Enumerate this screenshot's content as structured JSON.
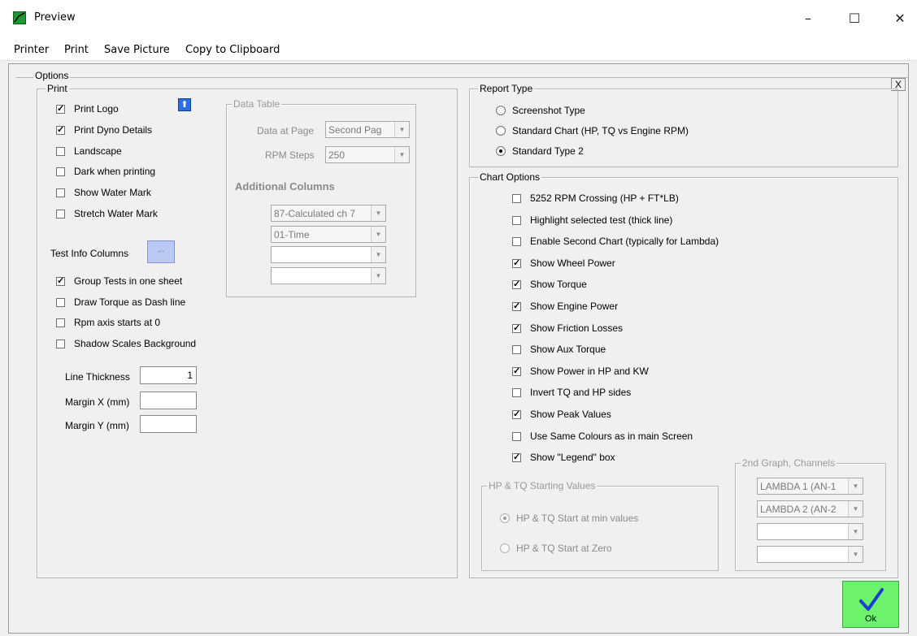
{
  "window": {
    "title": "Preview",
    "minimize": "–",
    "maximize": "☐",
    "close": "✕"
  },
  "menu": [
    "Printer",
    "Print",
    "Save Picture",
    "Copy to Clipboard"
  ],
  "options": {
    "legend": "Options",
    "close_label": "X",
    "print": {
      "legend": "Print",
      "checks": [
        {
          "label": "Print Logo",
          "checked": true
        },
        {
          "label": "Print Dyno Details",
          "checked": true
        },
        {
          "label": "Landscape",
          "checked": false
        },
        {
          "label": "Dark when printing",
          "checked": false
        },
        {
          "label": "Show Water Mark",
          "checked": false
        },
        {
          "label": "Stretch Water Mark",
          "checked": false
        }
      ],
      "test_info_label": "Test Info Columns",
      "more_button": "...",
      "checks2": [
        {
          "label": "Group Tests in one sheet",
          "checked": true
        },
        {
          "label": "Draw Torque as Dash line",
          "checked": false
        },
        {
          "label": "Rpm axis starts at 0",
          "checked": false
        },
        {
          "label": "Shadow Scales Background",
          "checked": false
        }
      ],
      "line_thickness_label": "Line Thickness",
      "line_thickness_value": "1",
      "margin_x_label": "Margin X (mm)",
      "margin_x_value": "",
      "margin_y_label": "Margin Y (mm)",
      "margin_y_value": ""
    },
    "data_table": {
      "legend": "Data Table",
      "data_at_page_label": "Data at Page",
      "data_at_page_value": "Second Pag",
      "rpm_steps_label": "RPM Steps",
      "rpm_steps_value": "250",
      "additional_columns_label": "Additional Columns",
      "columns": [
        "87-Calculated ch 7",
        "01-Time",
        "",
        ""
      ]
    },
    "report_type": {
      "legend": "Report Type",
      "items": [
        {
          "label": "Screenshot Type",
          "selected": false
        },
        {
          "label": "Standard Chart (HP, TQ vs Engine RPM)",
          "selected": false
        },
        {
          "label": "Standard Type 2",
          "selected": true
        }
      ]
    },
    "chart_options": {
      "legend": "Chart Options",
      "checks": [
        {
          "label": "5252 RPM Crossing (HP + FT*LB)",
          "checked": false
        },
        {
          "label": "Highlight selected test (thick line)",
          "checked": false
        },
        {
          "label": "Enable Second Chart (typically for Lambda)",
          "checked": false
        },
        {
          "label": "Show Wheel Power",
          "checked": true
        },
        {
          "label": "Show Torque",
          "checked": true
        },
        {
          "label": "Show Engine Power",
          "checked": true
        },
        {
          "label": "Show Friction Losses",
          "checked": true
        },
        {
          "label": "Show Aux Torque",
          "checked": false
        },
        {
          "label": "Show Power in HP and KW",
          "checked": true
        },
        {
          "label": "Invert TQ and HP sides",
          "checked": false
        },
        {
          "label": "Show Peak Values",
          "checked": true
        },
        {
          "label": "Use Same Colours as in main Screen",
          "checked": false
        },
        {
          "label": "Show \"Legend\" box",
          "checked": true
        }
      ],
      "starting_values": {
        "legend": "HP & TQ Starting Values",
        "items": [
          {
            "label": "HP & TQ Start at min values",
            "selected": true
          },
          {
            "label": "HP & TQ Start at Zero",
            "selected": false
          }
        ]
      },
      "second_graph": {
        "legend": "2nd Graph, Channels",
        "channels": [
          "LAMBDA 1 (AN-1",
          "LAMBDA 2 (AN-2",
          "",
          ""
        ]
      }
    }
  },
  "ok_button": {
    "label": "Ok"
  },
  "colors": {
    "ok_green": "#6cf26c",
    "checkmark_blue": "#1a3fd0"
  }
}
